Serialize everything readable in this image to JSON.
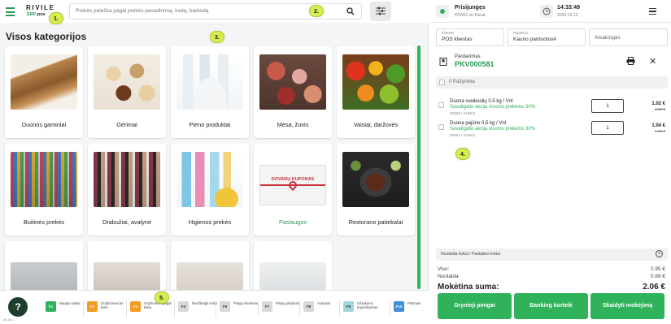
{
  "header": {
    "logo_name": "RIVILE",
    "logo_sub_green": "ERP",
    "logo_sub_dark": "pos",
    "search_placeholder": "Prekės paieška pagal prekės pavadinimą, kodą, barkodą",
    "icons": [
      "menu-icon",
      "search-icon",
      "filter-icon"
    ]
  },
  "markers": [
    "1.",
    "2.",
    "3.",
    "4.",
    "5."
  ],
  "page_title": "Visos kategorijos",
  "categories": [
    {
      "label": "Duonos gaminiai"
    },
    {
      "label": "Gėrimai"
    },
    {
      "label": "Pieno produktai"
    },
    {
      "label": "Mėsa, žuvis"
    },
    {
      "label": "Vaisiai, daržovės"
    },
    {
      "label": "Buitinės prekės"
    },
    {
      "label": "Drabužiai, avalynė"
    },
    {
      "label": "Higienos prekės"
    },
    {
      "label": "Paslaugos",
      "gift_text": "DOVANŲ KUPONAS"
    },
    {
      "label": "Restorano patiekalai"
    },
    {
      "label": ""
    },
    {
      "label": ""
    },
    {
      "label": ""
    },
    {
      "label": ""
    }
  ],
  "function_keys": [
    {
      "key": "F1",
      "label": "Naujas kvitas",
      "color": "#2fb25a"
    },
    {
      "key": "F2",
      "label": "Grąžinimas be kvito",
      "color": "#f59a23"
    },
    {
      "key": "F3",
      "label": "Grąžinimas pagal kvitą",
      "color": "#f59a23"
    },
    {
      "key": "F4",
      "label": "Neužbaigti kvitai",
      "color": "#d8d8d8"
    },
    {
      "key": "F5",
      "label": "Pinigų išėmimas",
      "color": "#d8d8d8"
    },
    {
      "key": "F7",
      "label": "Pinigų įdėjimas",
      "color": "#d8d8d8"
    },
    {
      "key": "F8",
      "label": "Avansas",
      "color": "#d8d8d8"
    },
    {
      "key": "F9",
      "label": "Užsakymo importavimas",
      "color": "#9fd4d8"
    },
    {
      "key": "F10",
      "label": "Pirkimas",
      "color": "#3f8ed8"
    }
  ],
  "help_label": "?",
  "version": "v8.34.1",
  "status": {
    "connected": "Prisijungęs",
    "pos": "POS02 ne Fiscal",
    "time": "14:33:49",
    "date": "2025-12-12"
  },
  "fields": {
    "client_label": "Klientas",
    "client_value": "POS klientas",
    "store_label": "Padalinys",
    "store_value": "Kauno parduotuvė",
    "responsible_placeholder": "Atsakingas"
  },
  "document": {
    "type": "Pardavimas",
    "number": "PKV000581"
  },
  "select_label": "0 Pažymėta",
  "lines": [
    {
      "name": "Duona sveikuolių 0,5 kg / Vnt",
      "promo": "Savaitgalio akcija visoms prekėms 30%",
      "code": "00003 / KUN01",
      "qty": "1",
      "price": "1.02 €",
      "old_price": "1.60 €"
    },
    {
      "name": "Duona pajūrio 0,5 kg / Vnt",
      "promo": "Savaitgalio akcija visoms prekėms 30%",
      "code": "00004 / KUN01",
      "qty": "1",
      "price": "1.04 €",
      "old_price": "1.49 €"
    }
  ],
  "discount_label": "Nuolaida kvitui / Pastabos kvitui",
  "totals": {
    "total_label": "Viso:",
    "total_value": "2.95 €",
    "discount_label": "Nuolaida:",
    "discount_value": "0.89 €",
    "due_label": "Mokėtina suma:",
    "due_value": "2.06 €"
  },
  "pay_buttons": {
    "cash": "Grynieji pinigai",
    "card": "Banking kortelė",
    "split": "Skaidyti mokėjimą"
  },
  "colors": {
    "accent": "#2fb25a",
    "marker": "#d7ec4f"
  }
}
